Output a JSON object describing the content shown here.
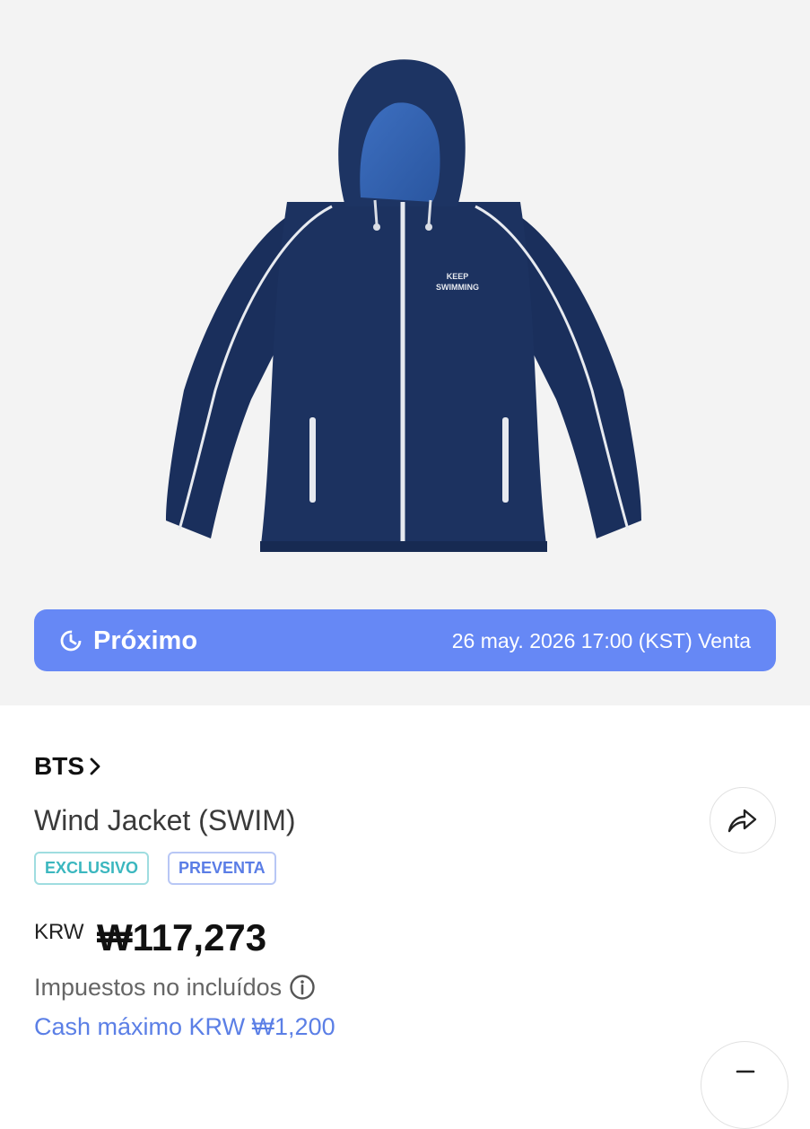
{
  "product_image": {
    "chest_print_line1": "KEEP",
    "chest_print_line2": "SWIMMING",
    "jacket_color": "#1c3260"
  },
  "status_banner": {
    "icon": "clock-icon",
    "label": "Próximo",
    "date_text": "26 may. 2026 17:00 (KST) Venta",
    "color": "#6688f5"
  },
  "artist": {
    "name": "BTS",
    "icon": "chevron-right-icon"
  },
  "product": {
    "title": "Wind Jacket (SWIM)",
    "share_icon": "share-icon"
  },
  "badges": {
    "exclusive": "EXCLUSIVO",
    "presale": "PREVENTA"
  },
  "price": {
    "currency": "KRW",
    "value": "₩117,273",
    "tax_note": "Impuestos no incluídos",
    "info_icon": "info-icon",
    "cash_note": "Cash máximo KRW ₩1,200"
  },
  "colors": {
    "accent": "#5b7fe6",
    "hero_background": "#f3f3f3"
  }
}
